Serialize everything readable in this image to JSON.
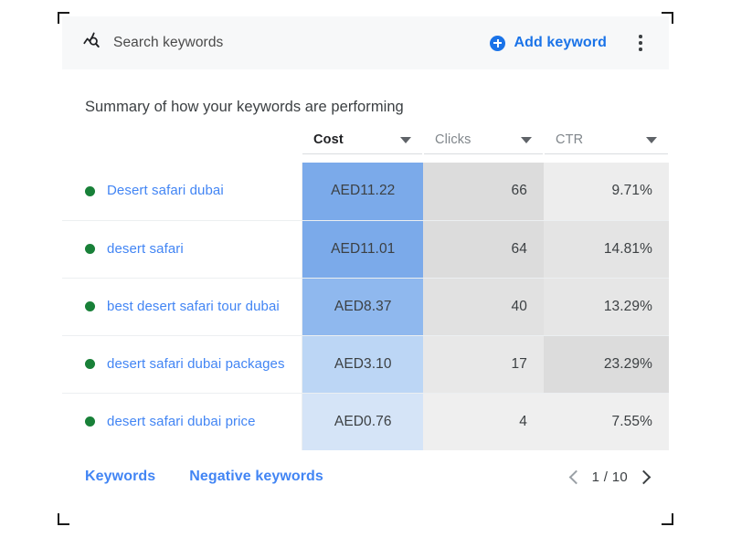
{
  "card": {
    "topbar": {
      "search_icon": "search-keywords-icon",
      "title": "Search keywords",
      "add_keyword_label": "Add keyword",
      "plus_icon": "plus-circle-icon",
      "overflow_icon": "more-vert-icon"
    },
    "summary_heading": "Summary of how your keywords are performing",
    "table": {
      "columns": [
        {
          "label": "",
          "key": "keyword",
          "sorted": false
        },
        {
          "label": "Cost",
          "key": "cost",
          "sorted": true
        },
        {
          "label": "Clicks",
          "key": "clicks",
          "sorted": false
        },
        {
          "label": "CTR",
          "key": "ctr",
          "sorted": false
        }
      ],
      "rows": [
        {
          "status": "enabled",
          "keyword": "Desert safari dubai",
          "cost": "AED11.22",
          "clicks": "66",
          "ctr": "9.71%",
          "cost_bg": "#7baaea",
          "clicks_bg": "#dcdcdc",
          "ctr_bg": "#ededed"
        },
        {
          "status": "enabled",
          "keyword": "desert safari",
          "cost": "AED11.01",
          "clicks": "64",
          "ctr": "14.81%",
          "cost_bg": "#7baaea",
          "clicks_bg": "#dcdcdc",
          "ctr_bg": "#e4e4e4"
        },
        {
          "status": "enabled",
          "keyword": "best desert safari tour dubai",
          "cost": "AED8.37",
          "clicks": "40",
          "ctr": "13.29%",
          "cost_bg": "#8fb8ee",
          "clicks_bg": "#e1e1e1",
          "ctr_bg": "#e6e6e6"
        },
        {
          "status": "enabled",
          "keyword": "desert safari dubai packages",
          "cost": "AED3.10",
          "clicks": "17",
          "ctr": "23.29%",
          "cost_bg": "#bcd6f5",
          "clicks_bg": "#e8e8e8",
          "ctr_bg": "#dcdcdc"
        },
        {
          "status": "enabled",
          "keyword": "desert safari dubai price",
          "cost": "AED0.76",
          "clicks": "4",
          "ctr": "7.55%",
          "cost_bg": "#d5e4f7",
          "clicks_bg": "#efefef",
          "ctr_bg": "#efefef"
        }
      ]
    },
    "footer": {
      "links": [
        {
          "label": "Keywords"
        },
        {
          "label": "Negative keywords"
        }
      ],
      "pagination": {
        "prev_icon": "chevron-left-icon",
        "page_label": "1 / 10",
        "next_icon": "chevron-right-icon"
      }
    }
  },
  "colors": {
    "accent_blue": "#1a73e8",
    "link_blue": "#4285f4",
    "status_green": "#188038",
    "topbar_bg": "#f7f8f9"
  }
}
